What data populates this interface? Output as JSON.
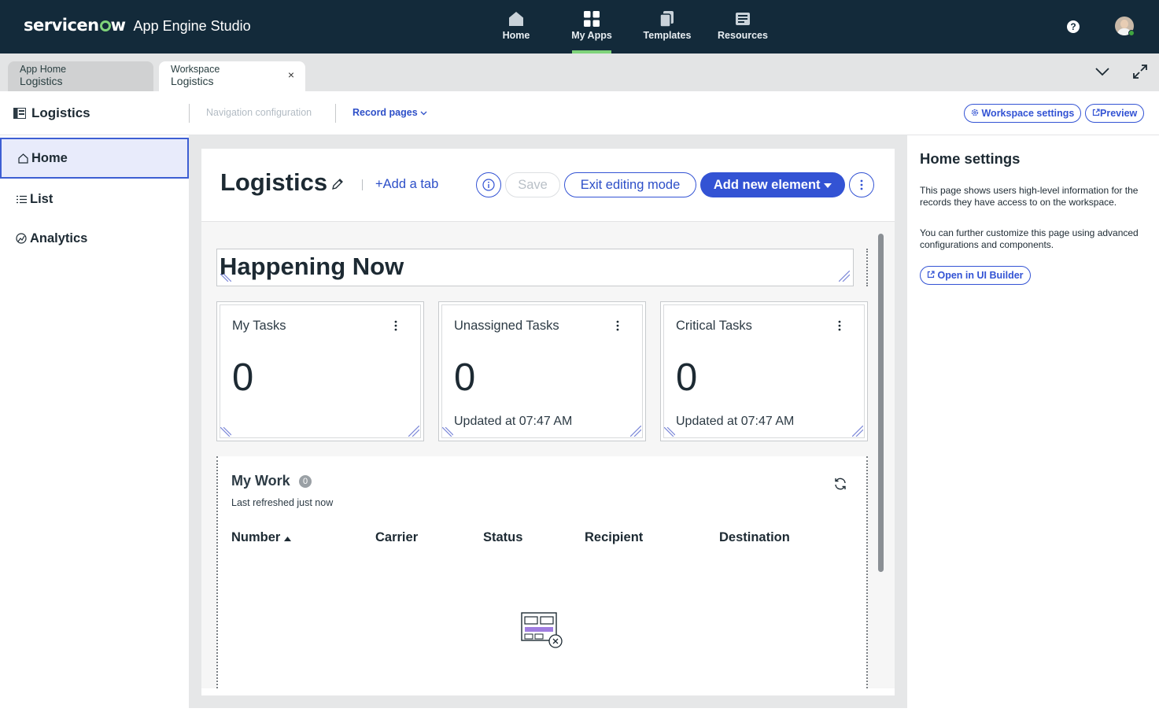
{
  "header": {
    "brand": "servicenow",
    "app_name": "App Engine Studio",
    "nav": [
      {
        "label": "Home",
        "icon": "home-icon"
      },
      {
        "label": "My Apps",
        "icon": "apps-grid-icon",
        "active": true
      },
      {
        "label": "Templates",
        "icon": "templates-icon"
      },
      {
        "label": "Resources",
        "icon": "resources-icon"
      }
    ],
    "help_label": "?",
    "accent_color": "#7fd37a"
  },
  "tabs": [
    {
      "line1": "App Home",
      "line2": "Logistics"
    },
    {
      "line1": "Workspace",
      "line2": "Logistics",
      "close": "×"
    }
  ],
  "subheader": {
    "title": "Logistics",
    "nav_config": "Navigation configuration",
    "record_pages": "Record pages",
    "workspace_settings": "Workspace settings",
    "preview": "Preview"
  },
  "leftnav": {
    "items": [
      {
        "label": "Home",
        "icon": "home-icon",
        "selected": true
      },
      {
        "label": "List",
        "icon": "list-icon"
      },
      {
        "label": "Analytics",
        "icon": "analytics-icon"
      }
    ]
  },
  "canvas": {
    "page_title": "Logistics",
    "add_tab": "Add a tab",
    "save": "Save",
    "exit_editing": "Exit editing mode",
    "add_new_element": "Add new element",
    "happening_now": "Happening Now",
    "cards": [
      {
        "title": "My Tasks",
        "value": "0",
        "updated": ""
      },
      {
        "title": "Unassigned Tasks",
        "value": "0",
        "updated": "Updated at 07:47 AM"
      },
      {
        "title": "Critical Tasks",
        "value": "0",
        "updated": "Updated at 07:47 AM"
      }
    ],
    "my_work": {
      "title": "My Work",
      "count": "0",
      "subtitle": "Last refreshed just now",
      "columns": [
        "Number",
        "Carrier",
        "Status",
        "Recipient",
        "Destination"
      ]
    },
    "primary_color": "#3353d4"
  },
  "settings_panel": {
    "title": "Home settings",
    "p1": "This page shows users high-level information for the records they have access to on the workspace.",
    "p2": "You can further customize this page using advanced configurations and components.",
    "open_ui_builder": "Open in UI Builder"
  }
}
